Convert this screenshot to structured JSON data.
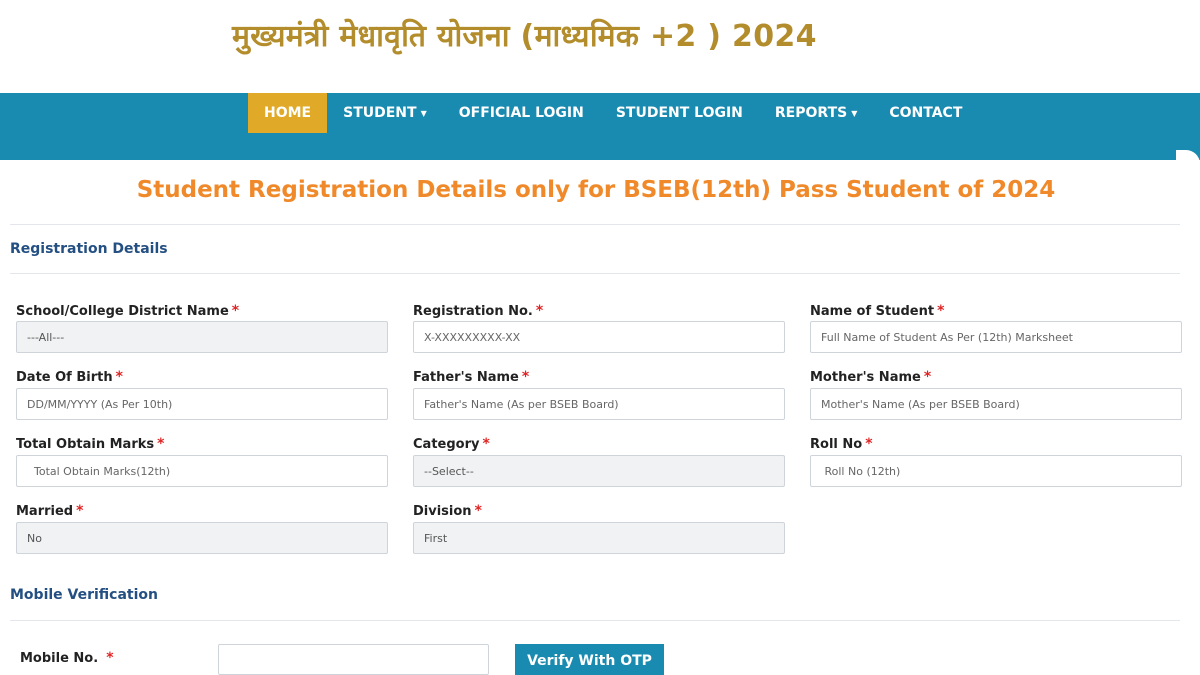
{
  "header": {
    "title": "मुख्यमंत्री  मेधावृति योजना (माध्यमिक +2 ) 2024"
  },
  "nav": {
    "items": [
      {
        "label": "HOME",
        "active": true,
        "dropdown": false
      },
      {
        "label": "STUDENT",
        "active": false,
        "dropdown": true
      },
      {
        "label": "OFFICIAL LOGIN",
        "active": false,
        "dropdown": false
      },
      {
        "label": "STUDENT LOGIN",
        "active": false,
        "dropdown": false
      },
      {
        "label": "REPORTS",
        "active": false,
        "dropdown": true
      },
      {
        "label": "CONTACT",
        "active": false,
        "dropdown": false
      }
    ],
    "caret": "▼"
  },
  "page": {
    "heading": "Student Registration Details only for BSEB(12th) Pass Student of 2024"
  },
  "registration": {
    "section_title": "Registration Details",
    "required_mark": "*",
    "fields": {
      "district": {
        "label": "School/College District Name",
        "value": "---All---"
      },
      "registration_no": {
        "label": "Registration No.",
        "placeholder": "X-XXXXXXXXX-XX"
      },
      "student_name": {
        "label": "Name of Student",
        "placeholder": "Full Name of Student As Per (12th) Marksheet"
      },
      "dob": {
        "label": "Date Of Birth",
        "placeholder": "DD/MM/YYYY (As Per 10th)"
      },
      "father_name": {
        "label": "Father's Name",
        "placeholder": "Father's Name (As per BSEB Board)"
      },
      "mother_name": {
        "label": "Mother's Name",
        "placeholder": "Mother's Name (As per BSEB Board)"
      },
      "total_marks": {
        "label": "Total Obtain Marks",
        "placeholder": "  Total Obtain Marks(12th)"
      },
      "category": {
        "label": "Category",
        "value": "--Select--"
      },
      "roll_no": {
        "label": "Roll No",
        "placeholder": " Roll No (12th)"
      },
      "married": {
        "label": "Married",
        "value": "No"
      },
      "division": {
        "label": "Division",
        "value": "First"
      }
    }
  },
  "mobile": {
    "section_title": "Mobile Verification",
    "label": "Mobile No.",
    "required_mark": "*",
    "button_label": "Verify With OTP"
  },
  "colors": {
    "nav_bg": "#1a8bb0",
    "nav_active": "#e0a927",
    "heading": "#f0892a",
    "title_gold": "#b38d2c",
    "section_blue": "#244f82",
    "required_red": "#e02424"
  }
}
